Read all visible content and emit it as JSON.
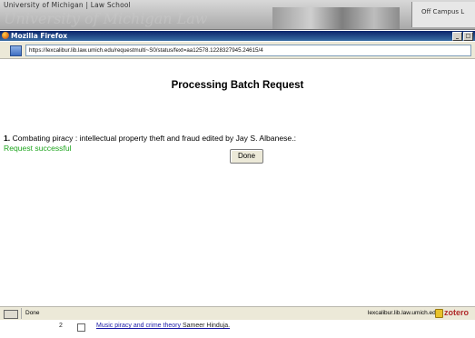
{
  "background": {
    "site_name": "University of Michigan | Law School",
    "banner_text": "University of Michigan Law",
    "campus_tab": "Off Campus L",
    "results": [
      {
        "num": "2",
        "title": "Music piracy and crime theory",
        "author": "Sameer Hinduja."
      }
    ]
  },
  "window": {
    "title": "Mozilla Firefox",
    "min_label": "_",
    "max_label": "□",
    "close_label": "x",
    "url": "https://lexcalibur.lib.law.umich.edu/requestmulti~S0/status/fext=aa12578.1228327945.24615/4"
  },
  "content": {
    "heading": "Processing Batch Request",
    "item_number": "1.",
    "item_text": "Combating piracy : intellectual property theft and fraud edited by Jay S. Albanese.:",
    "status": "Request successful",
    "done_label": "Done"
  },
  "statusbar": {
    "status": "Done",
    "domain": "lexcalibur.lib.law.umich.edu",
    "zotero": "zotero"
  }
}
